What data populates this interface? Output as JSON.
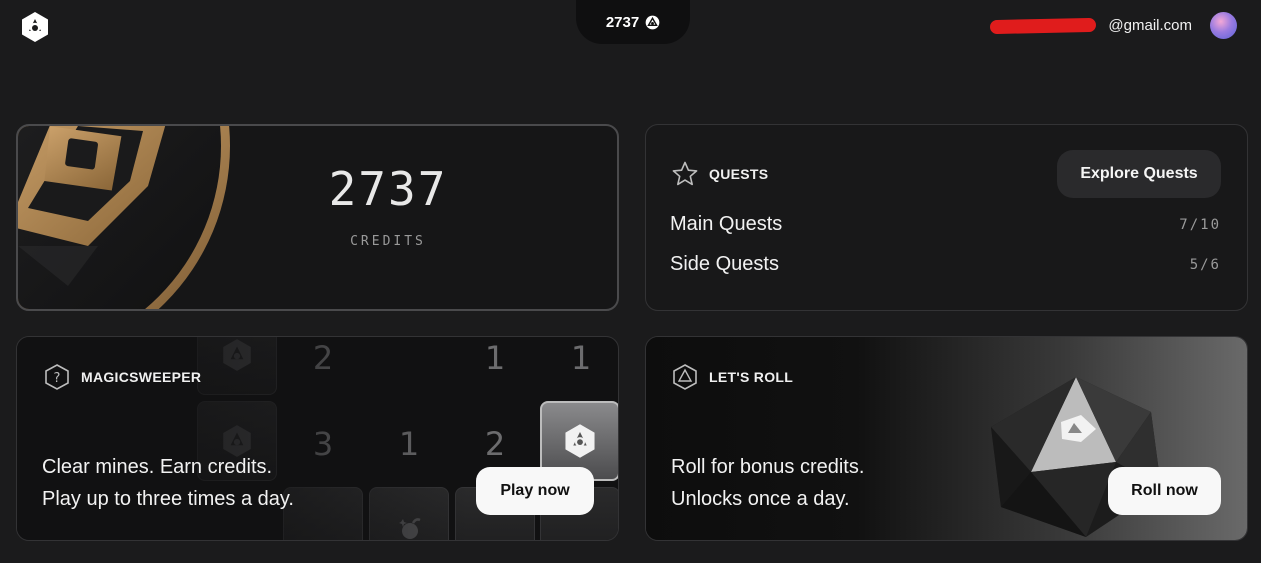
{
  "header": {
    "logo_icon": "hexagon-eye-icon",
    "credits_amount": "2737",
    "credits_icon": "coin-icon",
    "email": "@gmail.com",
    "avatar": "gradient-avatar"
  },
  "credits_card": {
    "value": "2737",
    "label": "CREDITS"
  },
  "quests": {
    "title": "QUESTS",
    "icon": "star-icon",
    "explore_label": "Explore Quests",
    "rows": [
      {
        "name": "Main Quests",
        "count": "7/10"
      },
      {
        "name": "Side Quests",
        "count": "5/6"
      }
    ]
  },
  "magicsweeper": {
    "title": "MAGICSWEEPER",
    "icon": "question-hexagon-icon",
    "line1": "Clear mines. Earn credits.",
    "line2": "Play up to three times a day.",
    "play_label": "Play now",
    "grid_numbers": [
      "2",
      "1",
      "1",
      "3",
      "1",
      "2"
    ]
  },
  "roll": {
    "title": "LET'S ROLL",
    "icon": "d20-icon",
    "line1": "Roll for bonus credits.",
    "line2": "Unlocks once a day.",
    "roll_label": "Roll now"
  },
  "colors": {
    "background": "#1b1b1c",
    "card": "#161617",
    "accent_gold": "#b88a52",
    "button_light": "#f8f8f8",
    "redaction": "#e01c1c"
  }
}
